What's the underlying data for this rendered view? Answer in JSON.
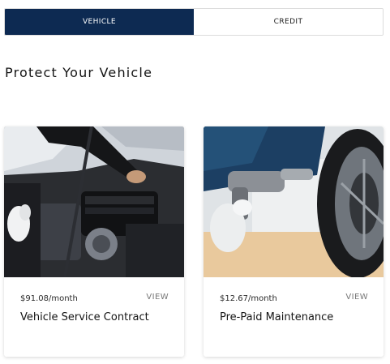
{
  "tabs": [
    {
      "label": "VEHICLE",
      "active": true
    },
    {
      "label": "CREDIT",
      "active": false
    }
  ],
  "section": {
    "title": "Protect Your Vehicle"
  },
  "cards": [
    {
      "price": "$91.08/month",
      "view_label": "VIEW",
      "title": "Vehicle Service Contract",
      "image": "engine-bay-photo"
    },
    {
      "price": "$12.67/month",
      "view_label": "VIEW",
      "title": "Pre-Paid Maintenance",
      "image": "impact-wrench-tire-photo"
    }
  ],
  "colors": {
    "tab_active_bg": "#0d2a52"
  }
}
